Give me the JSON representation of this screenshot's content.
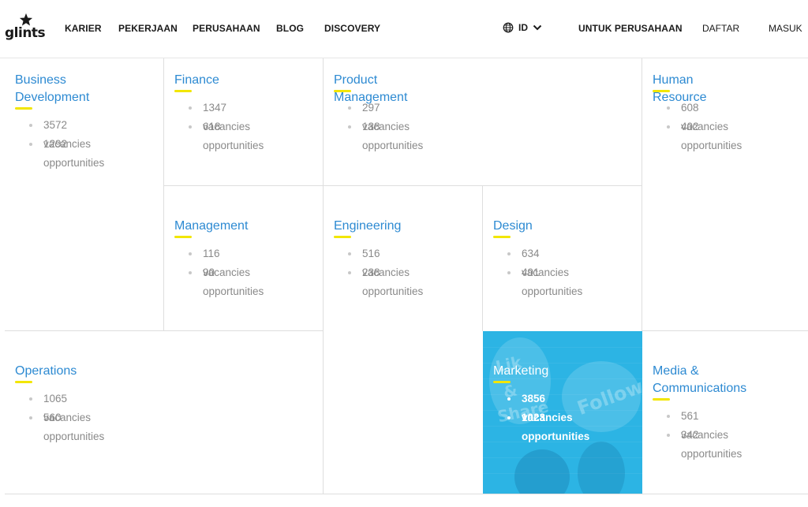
{
  "header": {
    "logo_text": "glints",
    "nav": [
      "KARIER",
      "PEKERJAAN",
      "PERUSAHAAN",
      "BLOG",
      "DISCOVERY"
    ],
    "language": "ID",
    "for_companies": "UNTUK PERUSAHAAN",
    "register": "DAFTAR",
    "login": "MASUK"
  },
  "categories": [
    {
      "title": "Business Development",
      "vacancies": "3572 vacancies",
      "opportunities": "1292 opportunities"
    },
    {
      "title": "Finance",
      "vacancies": "1347 vacancies",
      "opportunities": "618 opportunities"
    },
    {
      "title": "Product Management",
      "vacancies": "297 vacancies",
      "opportunities": "138 opportunities"
    },
    {
      "title": "Human Resource",
      "vacancies": "608 vacancies",
      "opportunities": "402 opportunities"
    },
    {
      "title": "Management",
      "vacancies": "116 vacancies",
      "opportunities": "90 opportunities"
    },
    {
      "title": "Engineering",
      "vacancies": "516 vacancies",
      "opportunities": "238 opportunities"
    },
    {
      "title": "Design",
      "vacancies": "634 vacancies",
      "opportunities": "491 opportunities"
    },
    {
      "title": "Operations",
      "vacancies": "1065 vacancies",
      "opportunities": "560 opportunities"
    },
    {
      "title": "Marketing",
      "vacancies": "3856 vacancies",
      "opportunities": "1023 opportunities"
    },
    {
      "title": "Media & Communications",
      "vacancies": "561 vacancies",
      "opportunities": "342 opportunities"
    }
  ],
  "colors": {
    "title_blue": "#2d8ad2",
    "underline_yellow": "#f2e600",
    "stat_gray": "#8a8a8a",
    "highlight_bg": "#2cb4e4"
  }
}
